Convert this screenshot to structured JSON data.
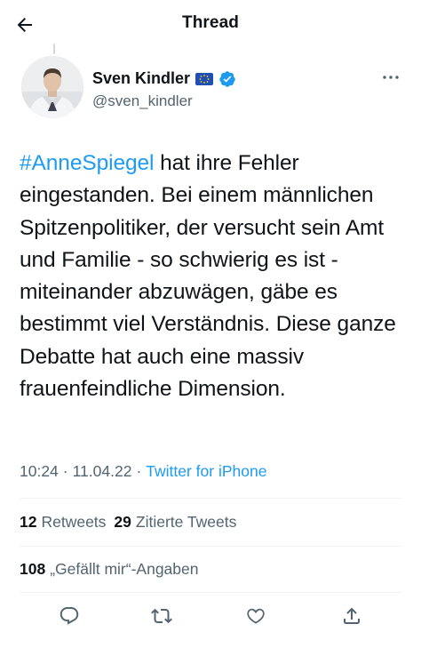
{
  "header": {
    "title": "Thread"
  },
  "author": {
    "name": "Sven Kindler",
    "handle": "@sven_kindler",
    "flag_emoji": "eu-flag-icon",
    "verified": true,
    "verified_color": "#1d9bf0"
  },
  "tweet": {
    "hashtag": "#AnneSpiegel",
    "text": " hat ihre Fehler eingestanden. Bei einem männlichen Spitzenpolitiker, der versucht sein Amt und Familie - so schwierig es ist - miteinander abzuwägen, gäbe es bestimmt viel Verständnis. Diese ganze Debatte hat auch eine massiv frauenfeindliche Dimension."
  },
  "meta": {
    "time": "10:24",
    "separator": "·",
    "date": "11.04.22",
    "source": "Twitter for iPhone"
  },
  "stats": {
    "retweets_count": "12",
    "retweets_label": "Retweets",
    "quotes_count": "29",
    "quotes_label": "Zitierte Tweets",
    "likes_count": "108",
    "likes_label": "„Gefällt mir“-Angaben"
  },
  "actions": [
    "reply-icon",
    "retweet-icon",
    "like-icon",
    "share-icon"
  ],
  "colors": {
    "accent": "#1d9bf0",
    "text": "#0f1419",
    "secondary": "#536471",
    "divider": "#eff3f4"
  }
}
